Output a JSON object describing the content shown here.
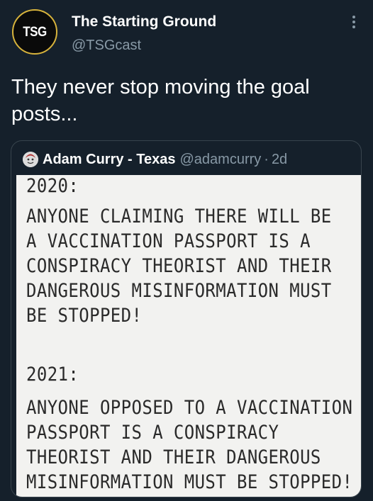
{
  "author": {
    "avatar_text": "TSG",
    "name": "The Starting Ground",
    "handle": "@TSGcast"
  },
  "tweet": {
    "text": "They never stop moving the goal posts..."
  },
  "quoted": {
    "name": "Adam Curry - Texas",
    "handle": "@adamcurry",
    "separator": "·",
    "time": "2d",
    "image_lines": [
      "2020:",
      "ANYONE CLAIMING THERE WILL BE",
      "A VACCINATION PASSPORT IS A",
      "CONSPIRACY THEORIST AND THEIR",
      "DANGEROUS MISINFORMATION MUST",
      "BE STOPPED!",
      "2021:",
      "ANYONE OPPOSED TO A VACCINATION",
      "PASSPORT IS A CONSPIRACY",
      "THEORIST AND THEIR DANGEROUS",
      "MISINFORMATION MUST BE STOPPED!"
    ]
  },
  "colors": {
    "background": "#15202b",
    "secondary_text": "#8899a6",
    "border": "#38444d",
    "avatar_ring": "#d7b33c"
  },
  "icons": {
    "more": "more-vertical-icon"
  }
}
